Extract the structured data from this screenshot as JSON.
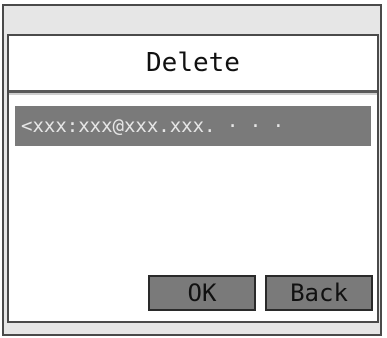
{
  "dialog": {
    "title": "Delete",
    "selected_entry": "<xxx:xxx@xxx.xxx. · · ·"
  },
  "buttons": {
    "ok_label": "OK",
    "back_label": "Back"
  }
}
